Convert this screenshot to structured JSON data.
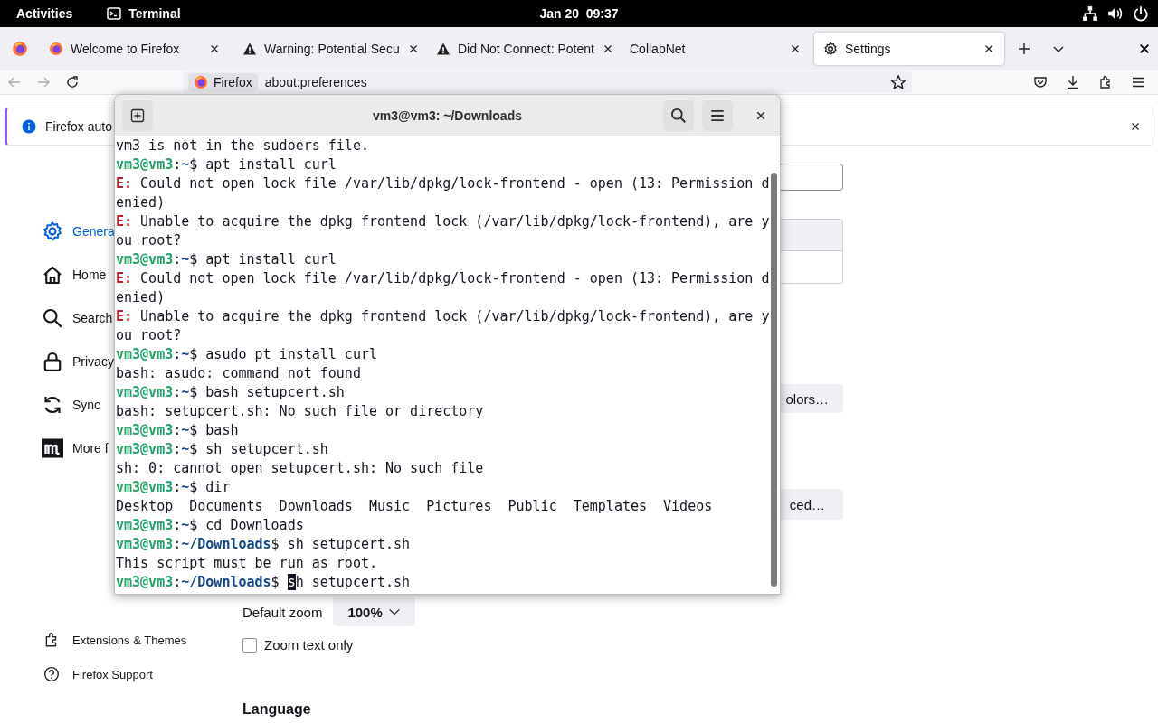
{
  "top_bar": {
    "activities": "Activities",
    "app": "Terminal",
    "clock": "Jan 20  09:37"
  },
  "tabs": [
    {
      "kind": "page",
      "title": "Welcome to Firefox",
      "selected": false
    },
    {
      "kind": "warning",
      "title": "Warning: Potential Secu",
      "selected": false
    },
    {
      "kind": "warning",
      "title": "Did Not Connect: Potent",
      "selected": false
    },
    {
      "kind": "blank",
      "title": "CollabNet",
      "selected": false
    },
    {
      "kind": "settings",
      "title": "Settings",
      "selected": true
    }
  ],
  "url_bar": {
    "identity": "Firefox",
    "url": "about:preferences"
  },
  "notification": {
    "text": "Firefox auto"
  },
  "sidebar": {
    "items": [
      {
        "label": "Genera",
        "selected": true
      },
      {
        "label": "Home",
        "selected": false
      },
      {
        "label": "Search",
        "selected": false
      },
      {
        "label": "Privacy",
        "selected": false
      },
      {
        "label": "Sync",
        "selected": false
      },
      {
        "label": "More f",
        "selected": false
      }
    ],
    "footer": [
      "Extensions & Themes",
      "Firefox Support"
    ]
  },
  "main": {
    "colors_button": "olors…",
    "advanced_button": "ced…",
    "zoom_label": "Default zoom",
    "zoom_value": "100%",
    "zoom_text_only": {
      "label": "Zoom text only",
      "checked": false
    },
    "language_heading": "Language"
  },
  "terminal": {
    "title": "vm3@vm3: ~/Downloads",
    "lines": [
      {
        "kind": "output",
        "text": "vm3 is not in the sudoers file."
      },
      {
        "kind": "prompt",
        "user": "vm3@vm3",
        "colon": ":",
        "path": "~",
        "dollar": "$",
        "command": "apt install curl"
      },
      {
        "kind": "error",
        "tag": "E:",
        "text": "Could not open lock file /var/lib/dpkg/lock-frontend - open (13: Permission d"
      },
      {
        "kind": "output",
        "text": "enied)"
      },
      {
        "kind": "error",
        "tag": "E:",
        "text": "Unable to acquire the dpkg frontend lock (/var/lib/dpkg/lock-frontend), are y"
      },
      {
        "kind": "output",
        "text": "ou root?"
      },
      {
        "kind": "prompt",
        "user": "vm3@vm3",
        "colon": ":",
        "path": "~",
        "dollar": "$",
        "command": "apt install curl"
      },
      {
        "kind": "error",
        "tag": "E:",
        "text": "Could not open lock file /var/lib/dpkg/lock-frontend - open (13: Permission d"
      },
      {
        "kind": "output",
        "text": "enied)"
      },
      {
        "kind": "error",
        "tag": "E:",
        "text": "Unable to acquire the dpkg frontend lock (/var/lib/dpkg/lock-frontend), are y"
      },
      {
        "kind": "output",
        "text": "ou root?"
      },
      {
        "kind": "prompt",
        "user": "vm3@vm3",
        "colon": ":",
        "path": "~",
        "dollar": "$",
        "command": "asudo pt install curl"
      },
      {
        "kind": "output",
        "text": "bash: asudo: command not found"
      },
      {
        "kind": "prompt",
        "user": "vm3@vm3",
        "colon": ":",
        "path": "~",
        "dollar": "$",
        "command": "bash setupcert.sh"
      },
      {
        "kind": "output",
        "text": "bash: setupcert.sh: No such file or directory"
      },
      {
        "kind": "prompt",
        "user": "vm3@vm3",
        "colon": ":",
        "path": "~",
        "dollar": "$",
        "command": "bash"
      },
      {
        "kind": "prompt",
        "user": "vm3@vm3",
        "colon": ":",
        "path": "~",
        "dollar": "$",
        "command": "sh setupcert.sh"
      },
      {
        "kind": "output",
        "text": "sh: 0: cannot open setupcert.sh: No such file"
      },
      {
        "kind": "prompt",
        "user": "vm3@vm3",
        "colon": ":",
        "path": "~",
        "dollar": "$",
        "command": "dir"
      },
      {
        "kind": "output",
        "text": "Desktop  Documents  Downloads  Music  Pictures  Public  Templates  Videos"
      },
      {
        "kind": "prompt",
        "user": "vm3@vm3",
        "colon": ":",
        "path": "~",
        "dollar": "$",
        "command": "cd Downloads"
      },
      {
        "kind": "prompt",
        "user": "vm3@vm3",
        "colon": ":",
        "path": "~/Downloads",
        "dollar": "$",
        "command": "sh setupcert.sh"
      },
      {
        "kind": "output",
        "text": "This script must be run as root."
      },
      {
        "kind": "prompt",
        "user": "vm3@vm3",
        "colon": ":",
        "path": "~/Downloads",
        "dollar": "$",
        "command": "sh setupcert.sh",
        "cursor": true
      }
    ]
  }
}
